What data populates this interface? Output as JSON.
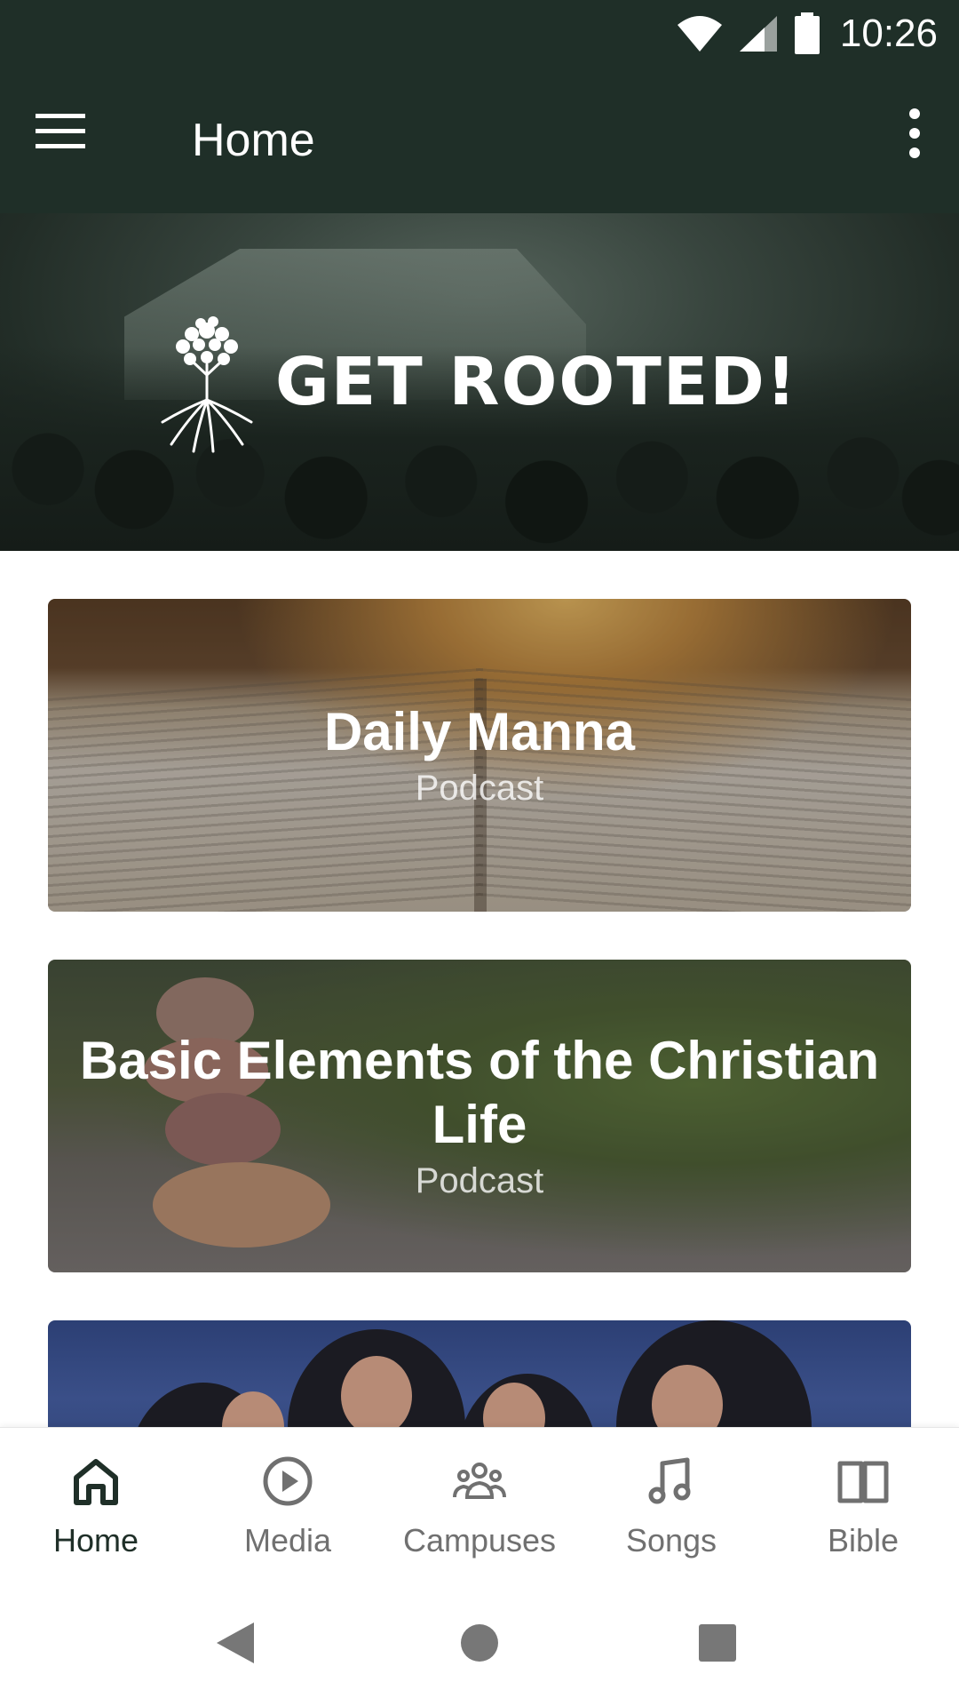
{
  "status_bar": {
    "time": "10:26"
  },
  "app_bar": {
    "title": "Home"
  },
  "hero": {
    "title": "GET ROOTED!"
  },
  "cards": [
    {
      "title": "Daily Manna",
      "subtitle": "Podcast"
    },
    {
      "title": "Basic Elements of the Christian Life",
      "subtitle": "Podcast"
    },
    {
      "title": "",
      "subtitle": ""
    }
  ],
  "bottom_nav": [
    {
      "label": "Home",
      "icon": "home-icon",
      "active": true
    },
    {
      "label": "Media",
      "icon": "play-circle-icon",
      "active": false
    },
    {
      "label": "Campuses",
      "icon": "group-icon",
      "active": false
    },
    {
      "label": "Songs",
      "icon": "music-note-icon",
      "active": false
    },
    {
      "label": "Bible",
      "icon": "book-icon",
      "active": false
    }
  ],
  "colors": {
    "primary": "#1f2f28",
    "inactive": "#707070"
  }
}
